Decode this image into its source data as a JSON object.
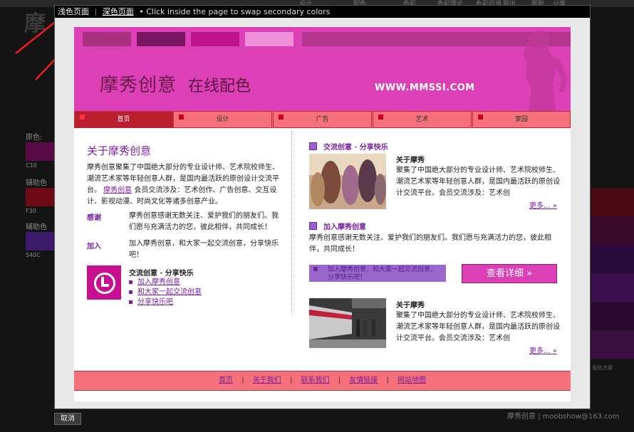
{
  "background": {
    "top_nav": [
      "设计",
      "配色",
      "色彩",
      "色彩理论",
      "色彩应用",
      "导出",
      "帮助",
      "分享"
    ],
    "logo": "摩",
    "left_labels": [
      "原色:",
      "辅助色 A",
      "辅助色 B"
    ],
    "left_codes": [
      "C10",
      "F30",
      "540C"
    ],
    "left_swatches": [
      "#5a0a45",
      "#6e0a16",
      "#3c1a6a"
    ],
    "right_swatches": [
      "#4a0a14",
      "#3a0a2a",
      "#2a0a3a",
      "#3a1050",
      "#2a0a30",
      "#3a1040"
    ],
    "brand": "摩秀创意 | moobshow@163.com",
    "small_text": "配色方案"
  },
  "cancel_button": "取消",
  "topbar": {
    "light_link": "浅色页面",
    "separator": "|",
    "dark_link": "深色页面",
    "hint": "• Click inside the page to swap secondary colors"
  },
  "header": {
    "logo_text": "摩秀创意",
    "logo_sub": "在线配色",
    "url": "WWW.MMSSI.COM",
    "colors": {
      "main": "#dd3fb6",
      "bar1": "#a8307f",
      "bar2": "#7a1560",
      "bar3": "#c0148c",
      "bar4": "#ee90d8",
      "bar5": "#b4358e"
    }
  },
  "nav": {
    "items": [
      {
        "label": "首页",
        "active": true
      },
      {
        "label": "设计",
        "active": false
      },
      {
        "label": "广告",
        "active": false
      },
      {
        "label": "艺术",
        "active": false
      },
      {
        "label": "家园",
        "active": false
      }
    ]
  },
  "left": {
    "title": "关于摩秀创意",
    "intro_1": "摩秀创意聚集了中国绝大部分的专业设计师、艺术院校师生、",
    "intro_2": "潮流艺术家等年轻创意人群，是国内最活跃的原创设计交流平",
    "intro_3_pre": "台。",
    "intro_link": "摩秀创意",
    "intro_3_post": "会员交流涉及：艺术创作、广告创意、交互设",
    "intro_4": "计、影视动漫、时尚文化等诸多创意产业。",
    "thanks_label": "感谢",
    "thanks_1": "摩秀创意感谢无数关注、爱护我们的朋友们。我",
    "thanks_2": "们愿与充满活力的您，彼此相伴，共同成长！",
    "join_label": "加入",
    "join_1": "加入摩秀创意，和大家一起交流创意，分享快乐",
    "join_2": "吧！",
    "sub_title": "交流创意 · 分享快乐",
    "links": [
      "加入摩秀创意",
      "和大家一起交流创意",
      "分享快乐吧"
    ]
  },
  "right": {
    "head1": "交流创意 · 分享快乐",
    "item1_title": "关于摩秀",
    "item1_1": "聚集了中国绝大部分的专业设计师、艺术院校师生、",
    "item1_2": "潮流艺术家等年轻创意人群，是国内最活跃的原创设",
    "item1_3": "计交流平台。会员交流涉及：艺术创",
    "more1": "更多... »",
    "head2": "加入摩秀创意",
    "join_1": "摩秀创意感谢无数关注、爱护我们的朋友们。我们愿与充满活力的您，彼此相",
    "join_2": "伴，共同成长！",
    "purple_box": "加入摩秀创意，和大家一起交流创意，分享快乐吧！",
    "detail_button": "查看详细 »",
    "item2_title": "关于摩秀",
    "item2_1": "聚集了中国绝大部分的专业设计师、艺术院校师生、",
    "item2_2": "潮流艺术家等年轻创意人群，是国内最活跃的原创设",
    "item2_3": "计交流平台。会员交流涉及：艺术创",
    "more2": "更多... »"
  },
  "footer": {
    "links": [
      "首页",
      "关于我们",
      "联系我们",
      "友情链接",
      "网站地图"
    ],
    "separator": "|"
  }
}
